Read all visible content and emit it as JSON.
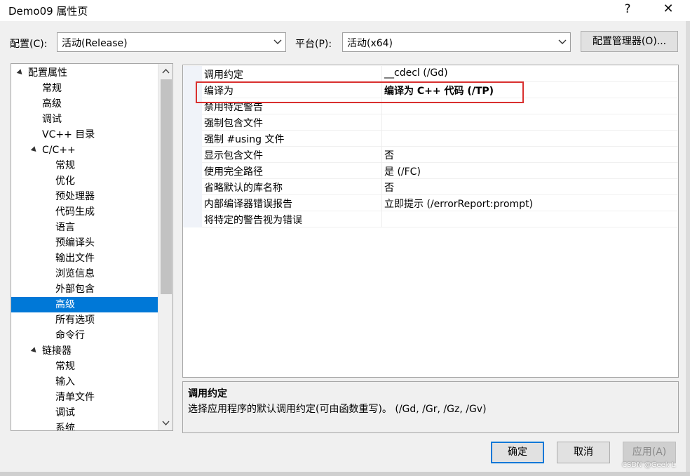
{
  "window": {
    "title": "Demo09 属性页",
    "help_label": "?",
    "close_label": "✕"
  },
  "toolbar": {
    "config_label": "配置(C):",
    "config_value": "活动(Release)",
    "platform_label": "平台(P):",
    "platform_value": "活动(x64)",
    "manager_label": "配置管理器(O)..."
  },
  "tree": {
    "items": [
      {
        "label": "配置属性",
        "expanded": true
      },
      {
        "label": "常规"
      },
      {
        "label": "高级"
      },
      {
        "label": "调试"
      },
      {
        "label": "VC++ 目录"
      },
      {
        "label": "C/C++",
        "expanded": true
      },
      {
        "label": "常规"
      },
      {
        "label": "优化"
      },
      {
        "label": "预处理器"
      },
      {
        "label": "代码生成"
      },
      {
        "label": "语言"
      },
      {
        "label": "预编译头"
      },
      {
        "label": "输出文件"
      },
      {
        "label": "浏览信息"
      },
      {
        "label": "外部包含"
      },
      {
        "label": "高级",
        "selected": true
      },
      {
        "label": "所有选项"
      },
      {
        "label": "命令行"
      },
      {
        "label": "链接器",
        "expanded": true
      },
      {
        "label": "常规"
      },
      {
        "label": "输入"
      },
      {
        "label": "清单文件"
      },
      {
        "label": "调试"
      },
      {
        "label": "系统"
      }
    ]
  },
  "grid": {
    "rows": [
      {
        "name": "调用约定",
        "value": "__cdecl (/Gd)"
      },
      {
        "name": "编译为",
        "value": "编译为 C++ 代码 (/TP)",
        "bold": true
      },
      {
        "name": "禁用特定警告",
        "value": ""
      },
      {
        "name": "强制包含文件",
        "value": ""
      },
      {
        "name": "强制 #using 文件",
        "value": ""
      },
      {
        "name": "显示包含文件",
        "value": "否"
      },
      {
        "name": "使用完全路径",
        "value": "是 (/FC)"
      },
      {
        "name": "省略默认的库名称",
        "value": "否"
      },
      {
        "name": "内部编译器错误报告",
        "value": "立即提示 (/errorReport:prompt)"
      },
      {
        "name": "将特定的警告视为错误",
        "value": ""
      }
    ]
  },
  "description": {
    "title": "调用约定",
    "text": "选择应用程序的默认调用约定(可由函数重写)。   (/Gd, /Gr, /Gz, /Gv)"
  },
  "buttons": {
    "ok": "确定",
    "cancel": "取消",
    "apply": "应用(A)"
  },
  "watermark": "CSDN @Geek L",
  "colors": {
    "selection": "#0078d7",
    "highlight_border": "#d9302f"
  }
}
